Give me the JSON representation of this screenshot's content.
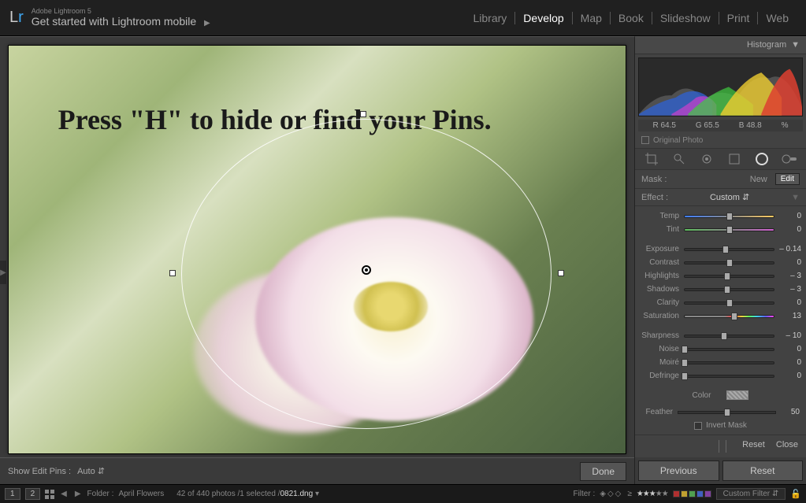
{
  "header": {
    "app_name_small": "Adobe Lightroom 5",
    "welcome": "Get started with Lightroom mobile",
    "modules": [
      "Library",
      "Develop",
      "Map",
      "Book",
      "Slideshow",
      "Print",
      "Web"
    ],
    "active_module": "Develop"
  },
  "canvas": {
    "overlay_text": "Press \"H\" to hide or find your Pins."
  },
  "canvas_footer": {
    "show_pins_label": "Show Edit Pins :",
    "show_pins_value": "Auto",
    "done": "Done"
  },
  "right": {
    "histogram_title": "Histogram",
    "rgb": {
      "r_label": "R",
      "r": "64.5",
      "g_label": "G",
      "g": "65.5",
      "b_label": "B",
      "b": "48.8",
      "pct": "%"
    },
    "original_photo": "Original Photo",
    "mask_label": "Mask :",
    "mask_new": "New",
    "mask_edit": "Edit",
    "effect_label": "Effect :",
    "effect_value": "Custom",
    "sliders": {
      "temp": {
        "label": "Temp",
        "value": "0",
        "pos": 50
      },
      "tint": {
        "label": "Tint",
        "value": "0",
        "pos": 50
      },
      "exposure": {
        "label": "Exposure",
        "value": "– 0.14",
        "pos": 46
      },
      "contrast": {
        "label": "Contrast",
        "value": "0",
        "pos": 50
      },
      "highlights": {
        "label": "Highlights",
        "value": "– 3",
        "pos": 48
      },
      "shadows": {
        "label": "Shadows",
        "value": "– 3",
        "pos": 48
      },
      "clarity": {
        "label": "Clarity",
        "value": "0",
        "pos": 50
      },
      "saturation": {
        "label": "Saturation",
        "value": "13",
        "pos": 56
      },
      "sharpness": {
        "label": "Sharpness",
        "value": "– 10",
        "pos": 44
      },
      "noise": {
        "label": "Noise",
        "value": "0",
        "pos": 0
      },
      "moire": {
        "label": "Moiré",
        "value": "0",
        "pos": 0
      },
      "defringe": {
        "label": "Defringe",
        "value": "0",
        "pos": 0
      }
    },
    "color_label": "Color",
    "feather_label": "Feather",
    "feather_value": "50",
    "invert_label": "Invert Mask",
    "reset": "Reset",
    "close": "Close",
    "previous": "Previous",
    "reset2": "Reset"
  },
  "bottom": {
    "page1": "1",
    "page2": "2",
    "folder_label": "Folder :",
    "folder": "April Flowers",
    "count": "42 of 440 photos /1 selected /",
    "filename": "0821.dng",
    "filter_label": "Filter :",
    "gte": "≥",
    "custom_filter": "Custom Filter"
  }
}
